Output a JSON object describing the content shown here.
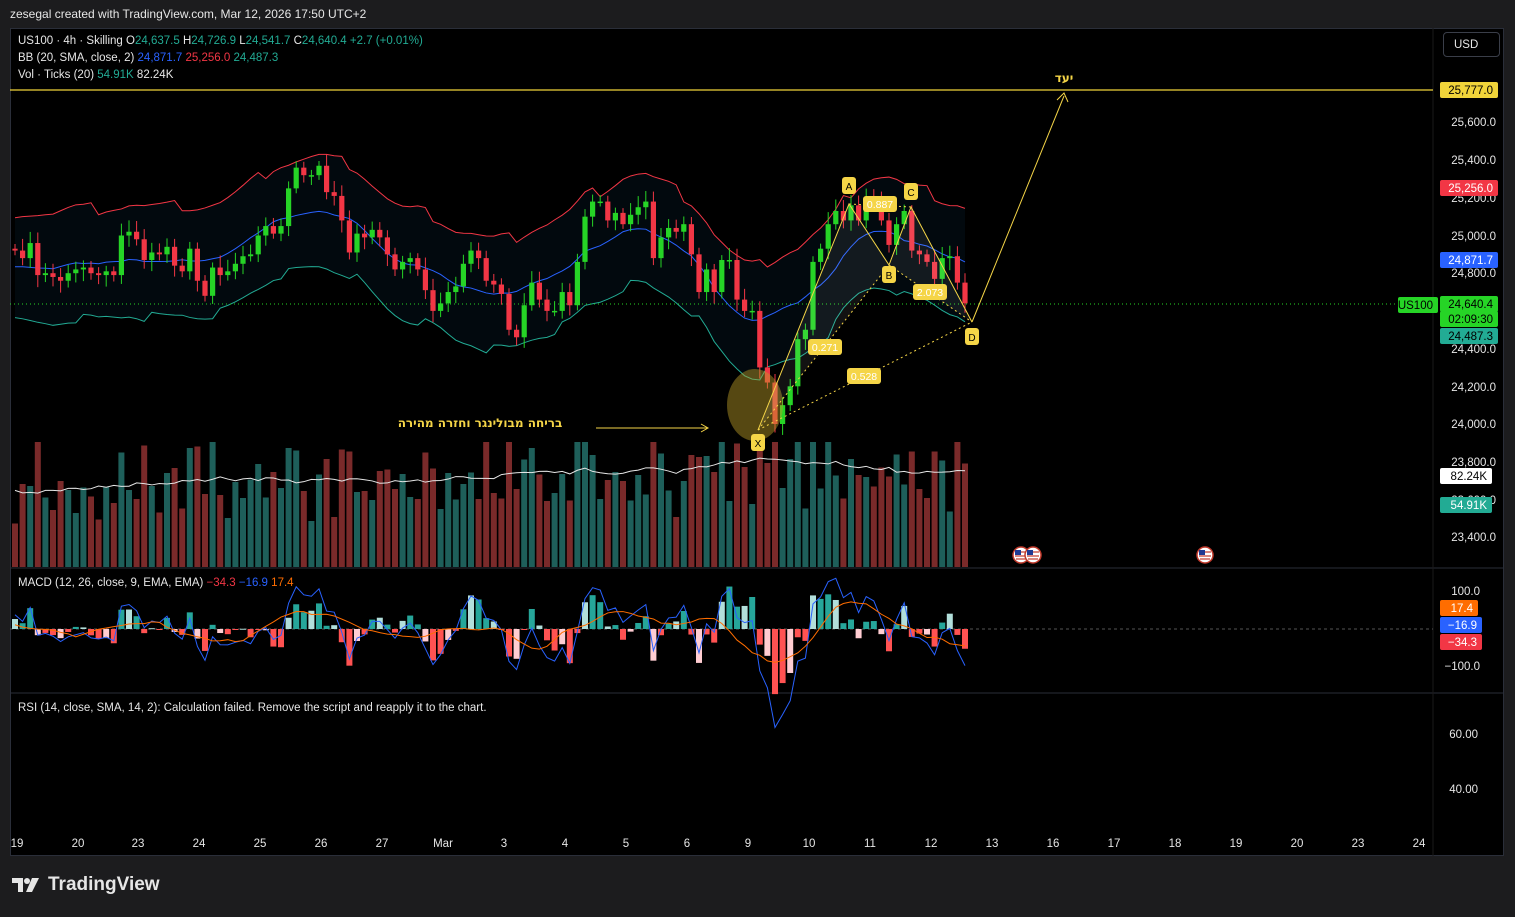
{
  "header": {
    "attribution": "zesegal created with TradingView.com, Mar 12, 2026 17:50 UTC+2"
  },
  "legend": {
    "symbol": "US100 · 4h · Skilling",
    "o_label": "O",
    "o": "24,637.5",
    "h_label": "H",
    "h": "24,726.9",
    "l_label": "L",
    "l": "24,541.7",
    "c_label": "C",
    "c": "24,640.4",
    "change": "+2.7 (+0.01%)",
    "bb_label": "BB (20, SMA, close, 2)",
    "bb_basis": "24,871.7",
    "bb_upper": "25,256.0",
    "bb_lower": "24,487.3",
    "vol_label": "Vol · Ticks (20)",
    "vol_ma": "54.91K",
    "vol": "82.24K",
    "macd_label": "MACD (12, 26, close, 9, EMA, EMA)",
    "macd_hist": "−34.3",
    "macd_line": "−16.9",
    "macd_signal": "17.4",
    "rsi_label": "RSI (14, close, SMA, 14, 2): Calculation failed. Remove the script and reapply it to the chart."
  },
  "currency_button": "USD",
  "price_axis": [
    "25,600.0",
    "25,400.0",
    "25,200.0",
    "25,000.0",
    "24,800.0",
    "24,600.0",
    "24,400.0",
    "24,200.0",
    "24,000.0",
    "23,800.0",
    "23,600.0",
    "23,400.0"
  ],
  "price_tags": {
    "target": "25,777.0",
    "bb_upper": "25,256.0",
    "bb_basis": "24,871.7",
    "last": "24,640.4",
    "countdown": "02:09:30",
    "bb_lower": "24,487.3",
    "symbol": "US100",
    "vol": "82.24K",
    "vol_ma": "54.91K"
  },
  "macd_axis": [
    "100.0",
    "−100.0"
  ],
  "macd_tags": {
    "signal": "17.4",
    "macd": "−16.9",
    "hist": "−34.3"
  },
  "rsi_axis": [
    "60.00",
    "40.00"
  ],
  "time_axis": [
    "19",
    "20",
    "23",
    "24",
    "25",
    "26",
    "27",
    "Mar",
    "3",
    "4",
    "5",
    "6",
    "9",
    "10",
    "11",
    "12",
    "13",
    "16",
    "17",
    "18",
    "19",
    "20",
    "23",
    "24"
  ],
  "annotations": {
    "target_label": "יעד",
    "breakout_note": "בריחה מבולינגר וחזרה מהירה",
    "points": [
      "X",
      "A",
      "B",
      "C",
      "D"
    ],
    "ratios": {
      "xb": "0.271",
      "ac": "0.887",
      "bd": "2.073",
      "xd": "0.528"
    }
  },
  "colors": {
    "up": "#26d426",
    "down": "#f23645",
    "bb_upper": "#f23645",
    "bb_basis": "#2962ff",
    "bb_lower": "#22ab94",
    "target": "#f0d43a",
    "annotation": "#f5d547"
  },
  "footer": {
    "brand": "TradingView"
  }
}
